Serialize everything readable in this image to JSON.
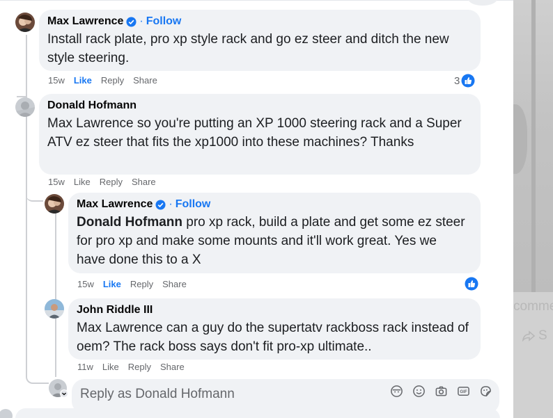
{
  "comments": [
    {
      "author": "Max Lawrence",
      "follow_label": "Follow",
      "separator": "·",
      "text": "Install rack plate, pro xp style rack and go ez steer and ditch the new style steering.",
      "time": "15w",
      "like_label": "Like",
      "reply_label": "Reply",
      "share_label": "Share",
      "reaction_count": "3"
    },
    {
      "author": "Donald Hofmann",
      "text": "Max Lawrence so you're putting an XP 1000 steering rack and a Super ATV ez steer that fits the xp1000 into these machines? Thanks",
      "time": "15w",
      "like_label": "Like",
      "reply_label": "Reply",
      "share_label": "Share"
    },
    {
      "author": "Max Lawrence",
      "follow_label": "Follow",
      "separator": "·",
      "mention": "Donald Hofmann",
      "text": " pro xp rack, build a plate and get some ez steer for pro xp and make some mounts and it'll work great. Yes we have done this to a X",
      "time": "15w",
      "like_label": "Like",
      "reply_label": "Reply",
      "share_label": "Share"
    },
    {
      "author": "John Riddle III",
      "text": "Max Lawrence can a guy do the supertatv rackboss rack instead of oem? The rack boss says don't fit pro-xp ultimate..",
      "time": "11w",
      "like_label": "Like",
      "reply_label": "Reply",
      "share_label": "Share"
    }
  ],
  "reply_box": {
    "placeholder": "Reply as Donald Hofmann",
    "icons": [
      "avatar-sticker-icon",
      "emoji-icon",
      "camera-icon",
      "gif-icon",
      "sticker-icon"
    ]
  },
  "background_post": {
    "comment_fragment": "comme",
    "share_fragment": "S"
  },
  "colors": {
    "link_blue": "#1877f2",
    "bubble_gray": "#f0f2f5",
    "meta_gray": "#65676b"
  }
}
